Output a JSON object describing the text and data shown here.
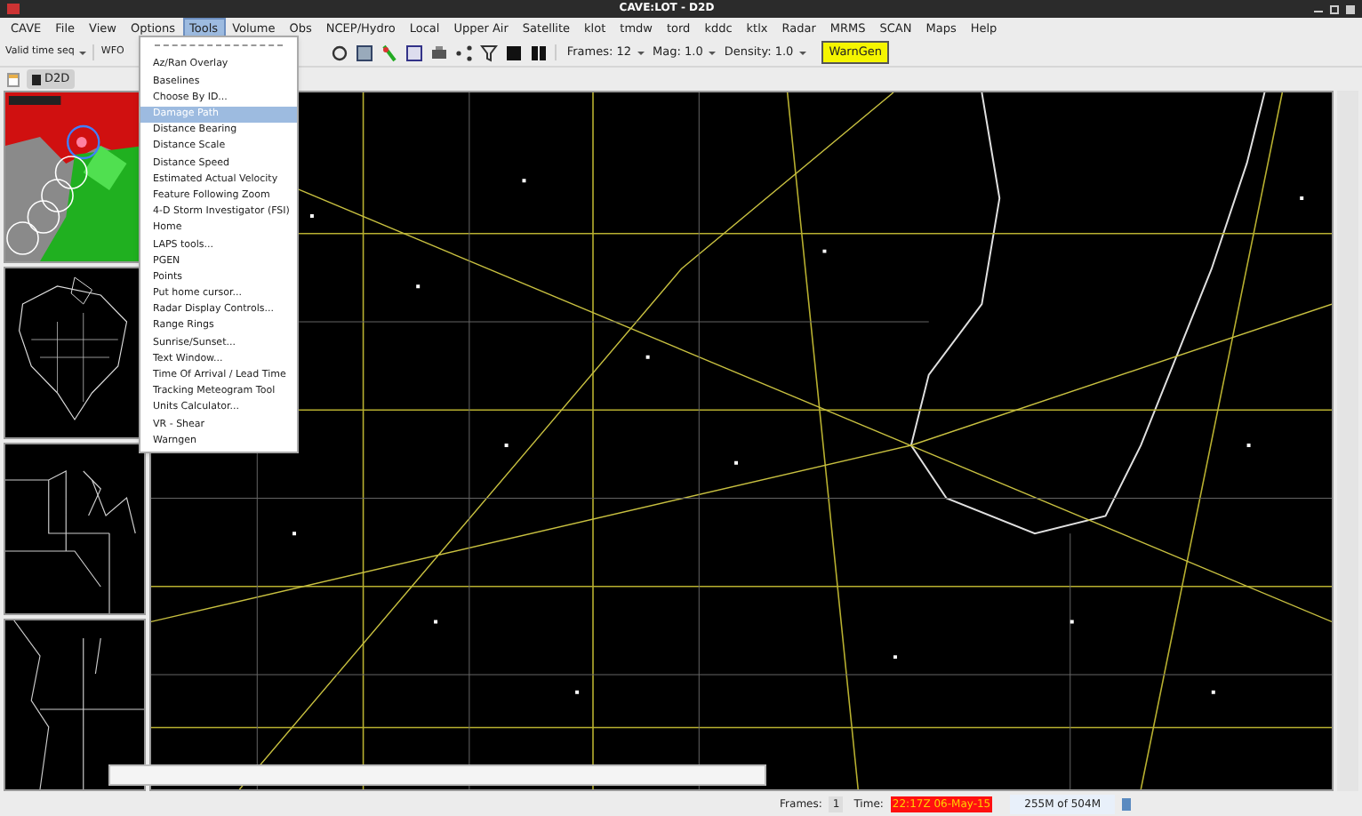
{
  "window": {
    "title": "CAVE:LOT - D2D"
  },
  "menu_bar": [
    {
      "label": "CAVE",
      "selected": false
    },
    {
      "label": "File",
      "selected": false
    },
    {
      "label": "View",
      "selected": false
    },
    {
      "label": "Options",
      "selected": false
    },
    {
      "label": "Tools",
      "selected": true
    },
    {
      "label": "Volume",
      "selected": false
    },
    {
      "label": "Obs",
      "selected": false
    },
    {
      "label": "NCEP/Hydro",
      "selected": false
    },
    {
      "label": "Local",
      "selected": false
    },
    {
      "label": "Upper Air",
      "selected": false
    },
    {
      "label": "Satellite",
      "selected": false
    },
    {
      "label": "klot",
      "selected": false
    },
    {
      "label": "tmdw",
      "selected": false
    },
    {
      "label": "tord",
      "selected": false
    },
    {
      "label": "kddc",
      "selected": false
    },
    {
      "label": "ktlx",
      "selected": false
    },
    {
      "label": "Radar",
      "selected": false
    },
    {
      "label": "MRMS",
      "selected": false
    },
    {
      "label": "SCAN",
      "selected": false
    },
    {
      "label": "Maps",
      "selected": false
    },
    {
      "label": "Help",
      "selected": false
    }
  ],
  "toolbar": {
    "time_mode": "Valid time seq",
    "wfo": "WFO",
    "frames": "Frames: 12",
    "mag": "Mag: 1.0",
    "density": "Density: 1.0",
    "warngen": "WarnGen"
  },
  "editor_tab": {
    "label": "D2D"
  },
  "tools_menu": {
    "items": [
      {
        "label": "Az/Ran Overlay",
        "selected": false
      },
      {
        "label": "Baselines",
        "selected": false
      },
      {
        "label": "Choose By ID...",
        "selected": false
      },
      {
        "label": "Damage Path",
        "selected": true
      },
      {
        "label": "Distance Bearing",
        "selected": false
      },
      {
        "label": "Distance Scale",
        "selected": false
      },
      {
        "label": "Distance Speed",
        "selected": false
      },
      {
        "label": "Estimated Actual Velocity",
        "selected": false
      },
      {
        "label": "Feature Following Zoom",
        "selected": false
      },
      {
        "label": "4-D Storm Investigator (FSI)",
        "selected": false
      },
      {
        "label": "Home",
        "selected": false
      },
      {
        "label": "LAPS tools...",
        "selected": false
      },
      {
        "label": "PGEN",
        "selected": false
      },
      {
        "label": "Points",
        "selected": false
      },
      {
        "label": "Put home cursor...",
        "selected": false
      },
      {
        "label": "Radar Display Controls...",
        "selected": false
      },
      {
        "label": "Range Rings",
        "selected": false
      },
      {
        "label": "Sunrise/Sunset...",
        "selected": false
      },
      {
        "label": "Text Window...",
        "selected": false
      },
      {
        "label": "Time Of Arrival / Lead Time",
        "selected": false
      },
      {
        "label": "Tracking Meteogram Tool",
        "selected": false
      },
      {
        "label": "Units Calculator...",
        "selected": false
      },
      {
        "label": "VR - Shear",
        "selected": false
      },
      {
        "label": "Warngen",
        "selected": false
      }
    ]
  },
  "status_bar": {
    "frames_label": "Frames:",
    "frames": "1",
    "time_label": "Time:",
    "time": "22:17Z 06-May-15",
    "memory": "255M of 504M"
  }
}
